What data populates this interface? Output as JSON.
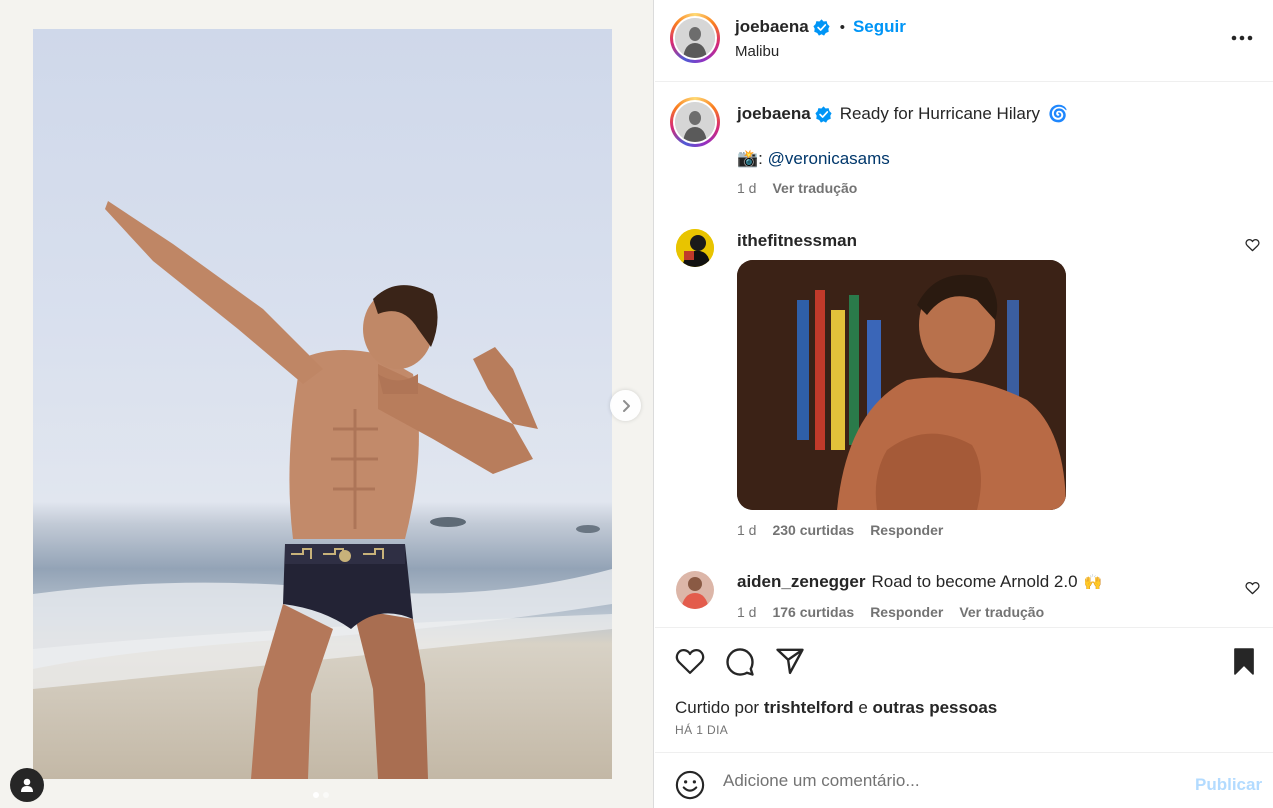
{
  "post": {
    "author": "joebaena",
    "location": "Malibu",
    "follow_label": "Seguir",
    "header_separator": "•",
    "carousel": {
      "current_slide": 1,
      "total_slides": 2
    }
  },
  "caption": {
    "author": "joebaena",
    "text": "Ready for Hurricane Hilary",
    "emoji": "🌀",
    "credit_emoji": "📸",
    "credit_sep": ":",
    "credit_mention": "@veronicasams",
    "time": "1 d",
    "translate_label": "Ver tradução"
  },
  "comments": [
    {
      "author": "ithefitnessman",
      "text": "",
      "has_gif": true,
      "time": "1 d",
      "likes": "230 curtidas",
      "reply_label": "Responder"
    },
    {
      "author": "aiden_zenegger",
      "text": "Road to become Arnold 2.0",
      "emoji": "🙌",
      "time": "1 d",
      "likes": "176 curtidas",
      "reply_label": "Responder",
      "translate_label": "Ver tradução"
    }
  ],
  "likes_line": {
    "prefix": "Curtido por",
    "user": "trishtelford",
    "conjunction": "e",
    "others": "outras pessoas"
  },
  "date_label": "HÁ 1 DIA",
  "composer": {
    "placeholder": "Adicione um comentário...",
    "publish_label": "Publicar"
  },
  "icons": {
    "like": "heart-icon",
    "comment": "comment-bubble-icon",
    "share": "paper-plane-icon",
    "save": "bookmark-filled-icon",
    "more": "more-horizontal-icon",
    "emoji": "emoji-smile-icon",
    "verified": "verified-badge-icon",
    "tag": "user-tag-icon",
    "next": "chevron-right-icon"
  },
  "colors": {
    "accent": "#0095f6",
    "verified": "#0095f6",
    "publish_disabled": "#b3dbff",
    "text": "#262626",
    "secondary": "#737373",
    "mention": "#00376b"
  }
}
